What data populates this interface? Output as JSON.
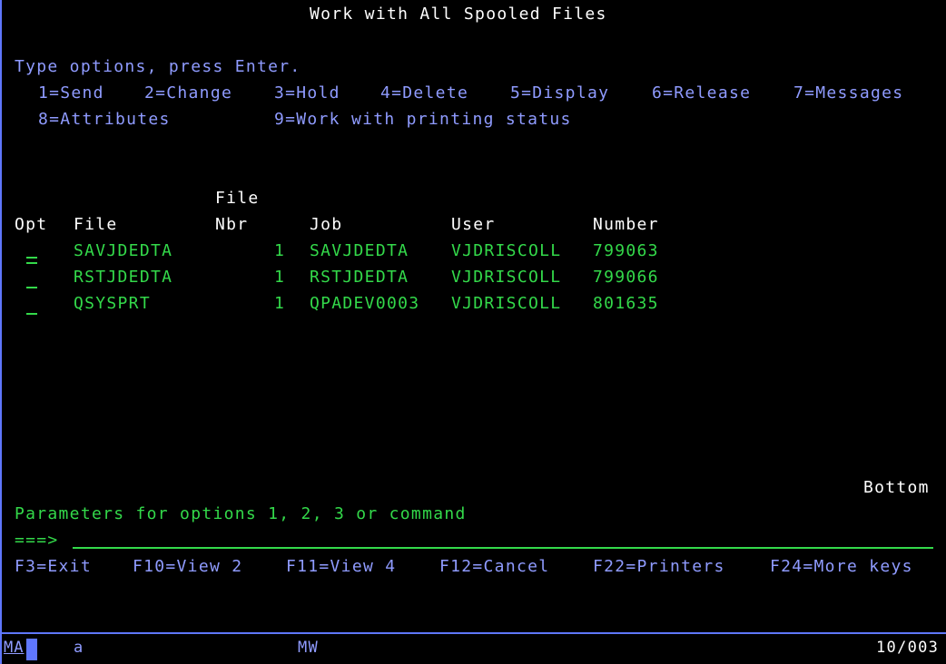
{
  "screen": {
    "title": "Work with All Spooled Files"
  },
  "instructions": {
    "prompt": "Type options, press Enter.",
    "options": [
      "1=Send",
      "2=Change",
      "3=Hold",
      "4=Delete",
      "5=Display",
      "6=Release",
      "7=Messages",
      "8=Attributes",
      "9=Work with printing status"
    ]
  },
  "table": {
    "headers": {
      "opt": "Opt",
      "file": "File",
      "file_nbr_top": "File",
      "file_nbr_bottom": "Nbr",
      "job": "Job",
      "user": "User",
      "number": "Number"
    },
    "rows": [
      {
        "file": "SAVJDEDTA",
        "nbr": "1",
        "job": "SAVJDEDTA",
        "user": "VJDRISCOLL",
        "number": "799063",
        "opt_value": "="
      },
      {
        "file": "RSTJDEDTA",
        "nbr": "1",
        "job": "RSTJDEDTA",
        "user": "VJDRISCOLL",
        "number": "799066",
        "opt_value": "_"
      },
      {
        "file": "QSYSPRT",
        "nbr": "1",
        "job": "QPADEV0003",
        "user": "VJDRISCOLL",
        "number": "801635",
        "opt_value": "_"
      }
    ],
    "position": "Bottom"
  },
  "command": {
    "label": "Parameters for options 1, 2, 3 or command",
    "prompt_arrow": "===>",
    "value": ""
  },
  "function_keys": [
    "F3=Exit",
    "F10=View 2",
    "F11=View 4",
    "F12=Cancel",
    "F22=Printers",
    "F24=More keys"
  ],
  "status_bar": {
    "session_indicator": "MA",
    "mode": "a",
    "input_indicator": "MW",
    "cursor_position": "10/003"
  },
  "colors": {
    "background": "#000000",
    "title": "#ffffff",
    "info": "#8f9bff",
    "data": "#33d94a",
    "frame": "#5f77ff"
  }
}
